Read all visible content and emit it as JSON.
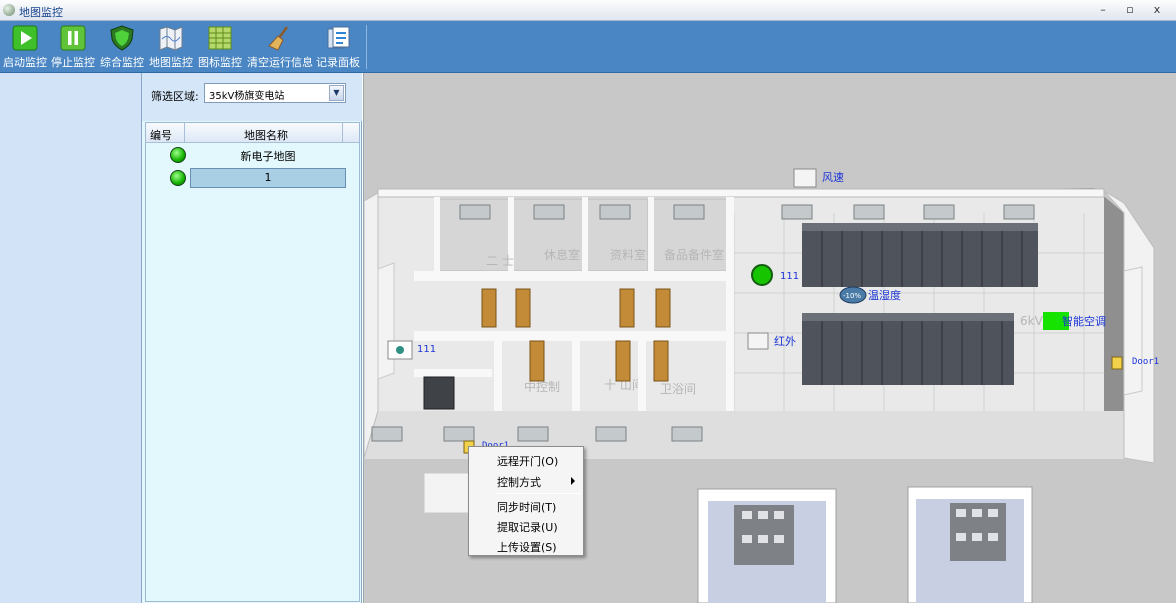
{
  "window": {
    "title": "地图监控",
    "minimize": "–",
    "restore": "▫",
    "close": "x"
  },
  "toolbar": {
    "buttons": [
      {
        "label": "启动监控",
        "icon": "play-icon"
      },
      {
        "label": "停止监控",
        "icon": "pause-icon"
      },
      {
        "label": "综合监控",
        "icon": "shield-icon"
      },
      {
        "label": "地图监控",
        "icon": "map-icon"
      },
      {
        "label": "图标监控",
        "icon": "grid-icon"
      },
      {
        "label": "清空运行信息",
        "icon": "broom-icon"
      },
      {
        "label": "记录面板",
        "icon": "record-panel-icon"
      }
    ]
  },
  "filter": {
    "label": "筛选区域:",
    "selected": "35kV杨旗变电站"
  },
  "grid": {
    "columns": [
      "编号",
      "地图名称"
    ],
    "rows": [
      {
        "name": "新电子地图",
        "status": "online"
      },
      {
        "name": "1",
        "status": "online",
        "selected": true
      }
    ]
  },
  "map": {
    "rooms": [
      "二 士",
      "休息室",
      "资料室",
      "备品备件室",
      "中控制",
      "十 山间",
      "卫浴间",
      "6kV"
    ],
    "devices": [
      {
        "name": "风速"
      },
      {
        "name": "111"
      },
      {
        "name": "温湿度"
      },
      {
        "name": "智能空调"
      },
      {
        "name": "红外"
      },
      {
        "name": "111"
      },
      {
        "name": "Door1"
      },
      {
        "name": "Door1"
      }
    ],
    "humidity_badge": "-10%"
  },
  "context_menu": {
    "items": [
      {
        "label": "远程开门(O)"
      },
      {
        "label": "控制方式",
        "submenu": true
      },
      {
        "label": "同步时间(T)"
      },
      {
        "label": "提取记录(U)"
      },
      {
        "label": "上传设置(S)"
      }
    ]
  }
}
